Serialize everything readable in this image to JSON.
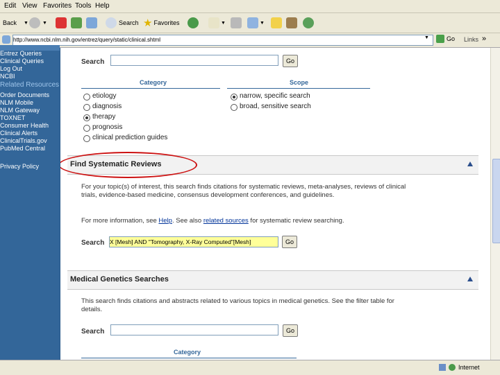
{
  "menu": [
    "Edit",
    "View",
    "Favorites",
    "Tools",
    "Help"
  ],
  "toolbar": {
    "back": "Back",
    "search": "Search",
    "favorites": "Favorites"
  },
  "address": {
    "url": "http://www.ncbi.nlm.nih.gov/entrez/query/static/clinical.shtml",
    "go": "Go",
    "links": "Links",
    "chevron": "»"
  },
  "sidebar": [
    "Entrez Queries",
    "Clinical Queries",
    "Log Out",
    "NCBI",
    "Related Resources",
    "Order Documents",
    "NLM Mobile",
    "NLM Gateway",
    "TOXNET",
    "Consumer Health",
    "Clinical Alerts",
    "ClinicalTrials.gov",
    "PubMed Central",
    "Privacy Policy"
  ],
  "clinical": {
    "search_label": "Search",
    "go": "Go",
    "category_header": "Category",
    "scope_header": "Scope",
    "categories": [
      "etiology",
      "diagnosis",
      "therapy",
      "prognosis",
      "clinical prediction guides"
    ],
    "selected_category": "therapy",
    "scopes": [
      "narrow, specific search",
      "broad, sensitive search"
    ],
    "selected_scope": "narrow, specific search"
  },
  "systematic": {
    "title": "Find Systematic Reviews",
    "desc": "For your topic(s) of interest, this search finds citations for systematic reviews, meta-analyses, reviews of clinical trials, evidence-based medicine, consensus development conferences, and guidelines.",
    "more_prefix": "For more information, see ",
    "help_link": "Help",
    "more_mid": ". See also ",
    "related_link": "related sources",
    "more_suffix": " for systematic review searching.",
    "search_label": "Search",
    "search_value": "X [Mesh] AND \"Tomography, X-Ray Computed\"[Mesh]",
    "go": "Go"
  },
  "genetics": {
    "title": "Medical Genetics Searches",
    "desc": "This search finds citations and abstracts related to various topics in medical genetics. See the filter table for details.",
    "search_label": "Search",
    "go": "Go",
    "category_header": "Category"
  },
  "status": {
    "zone": "Internet"
  },
  "colors": {
    "sidebar": "#336699",
    "highlight": "#ffff99",
    "annotation": "#cc1111",
    "accent_rule": "#336699"
  }
}
